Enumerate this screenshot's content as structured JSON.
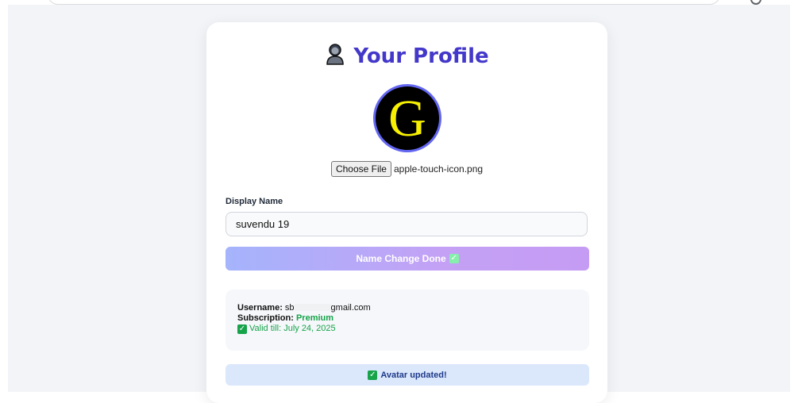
{
  "profile": {
    "title": "Your Profile",
    "title_icon": "person-icon",
    "avatar_letter": "G"
  },
  "file": {
    "button_label": "Choose File",
    "filename": "apple-touch-icon.png"
  },
  "name_field": {
    "label": "Display Name",
    "value": "suvendu 19"
  },
  "name_button": {
    "label": "Name Change Done",
    "icon": "check-mark-icon"
  },
  "account": {
    "username_label": "Username:",
    "username_prefix": "sb",
    "username_suffix": "gmail.com",
    "subscription_label": "Subscription:",
    "subscription_value": "Premium",
    "validity_text": "Valid till: July 24, 2025"
  },
  "status": {
    "message": "Avatar updated!"
  },
  "colors": {
    "accent": "#4338ca",
    "success": "#16a34a",
    "status_bg": "#dbe7fb"
  }
}
